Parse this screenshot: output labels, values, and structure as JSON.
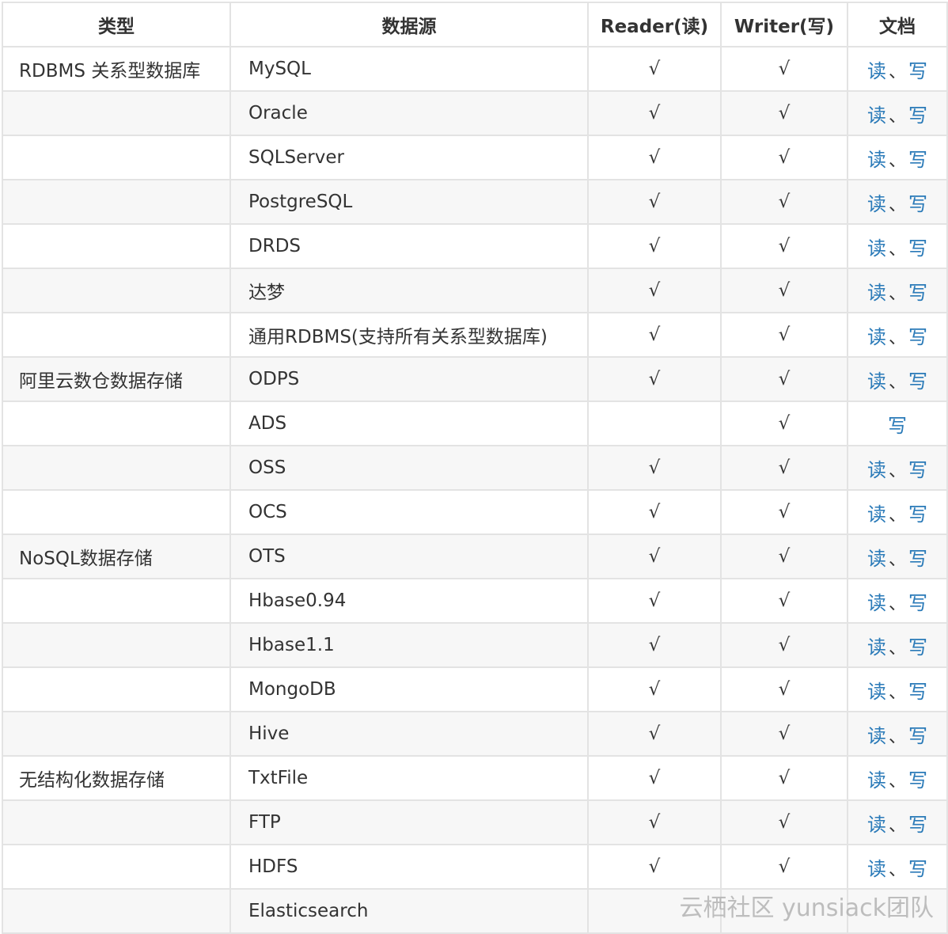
{
  "headers": {
    "type": "类型",
    "source": "数据源",
    "reader": "Reader(读)",
    "writer": "Writer(写)",
    "docs": "文档"
  },
  "rows": [
    {
      "type": "RDBMS 关系型数据库",
      "source": "MySQL",
      "reader": "√",
      "writer": "√",
      "doc_read": "读",
      "sep": "、",
      "doc_write": "写"
    },
    {
      "type": "",
      "source": "Oracle",
      "reader": "√",
      "writer": "√",
      "doc_read": "读",
      "sep": "、",
      "doc_write": "写"
    },
    {
      "type": "",
      "source": "SQLServer",
      "reader": "√",
      "writer": "√",
      "doc_read": "读",
      "sep": "、",
      "doc_write": "写"
    },
    {
      "type": "",
      "source": "PostgreSQL",
      "reader": "√",
      "writer": "√",
      "doc_read": "读",
      "sep": "、",
      "doc_write": "写"
    },
    {
      "type": "",
      "source": "DRDS",
      "reader": "√",
      "writer": "√",
      "doc_read": "读",
      "sep": "、",
      "doc_write": "写"
    },
    {
      "type": "",
      "source": "达梦",
      "reader": "√",
      "writer": "√",
      "doc_read": "读",
      "sep": "、",
      "doc_write": "写"
    },
    {
      "type": "",
      "source": "通用RDBMS(支持所有关系型数据库)",
      "reader": "√",
      "writer": "√",
      "doc_read": "读",
      "sep": "、",
      "doc_write": "写"
    },
    {
      "type": "阿里云数仓数据存储",
      "source": "ODPS",
      "reader": "√",
      "writer": "√",
      "doc_read": "读",
      "sep": "、",
      "doc_write": "写"
    },
    {
      "type": "",
      "source": "ADS",
      "reader": "",
      "writer": "√",
      "doc_read": "",
      "sep": "",
      "doc_write": "写"
    },
    {
      "type": "",
      "source": "OSS",
      "reader": "√",
      "writer": "√",
      "doc_read": "读",
      "sep": "、",
      "doc_write": "写"
    },
    {
      "type": "",
      "source": "OCS",
      "reader": "√",
      "writer": "√",
      "doc_read": "读",
      "sep": "、",
      "doc_write": "写"
    },
    {
      "type": "NoSQL数据存储",
      "source": "OTS",
      "reader": "√",
      "writer": "√",
      "doc_read": "读",
      "sep": "、",
      "doc_write": "写"
    },
    {
      "type": "",
      "source": "Hbase0.94",
      "reader": "√",
      "writer": "√",
      "doc_read": "读",
      "sep": "、",
      "doc_write": "写"
    },
    {
      "type": "",
      "source": "Hbase1.1",
      "reader": "√",
      "writer": "√",
      "doc_read": "读",
      "sep": "、",
      "doc_write": "写"
    },
    {
      "type": "",
      "source": "MongoDB",
      "reader": "√",
      "writer": "√",
      "doc_read": "读",
      "sep": "、",
      "doc_write": "写"
    },
    {
      "type": "",
      "source": "Hive",
      "reader": "√",
      "writer": "√",
      "doc_read": "读",
      "sep": "、",
      "doc_write": "写"
    },
    {
      "type": "无结构化数据存储",
      "source": "TxtFile",
      "reader": "√",
      "writer": "√",
      "doc_read": "读",
      "sep": "、",
      "doc_write": "写"
    },
    {
      "type": "",
      "source": "FTP",
      "reader": "√",
      "writer": "√",
      "doc_read": "读",
      "sep": "、",
      "doc_write": "写"
    },
    {
      "type": "",
      "source": "HDFS",
      "reader": "√",
      "writer": "√",
      "doc_read": "读",
      "sep": "、",
      "doc_write": "写"
    },
    {
      "type": "",
      "source": "Elasticsearch",
      "reader": "",
      "writer": "",
      "doc_read": "",
      "sep": "",
      "doc_write": ""
    }
  ],
  "watermark": "云栖社区 yunsiack团队",
  "colors": {
    "link": "#2a7ab8",
    "text": "#333333",
    "border": "#e3e3e3",
    "stripe": "#f7f7f7"
  }
}
